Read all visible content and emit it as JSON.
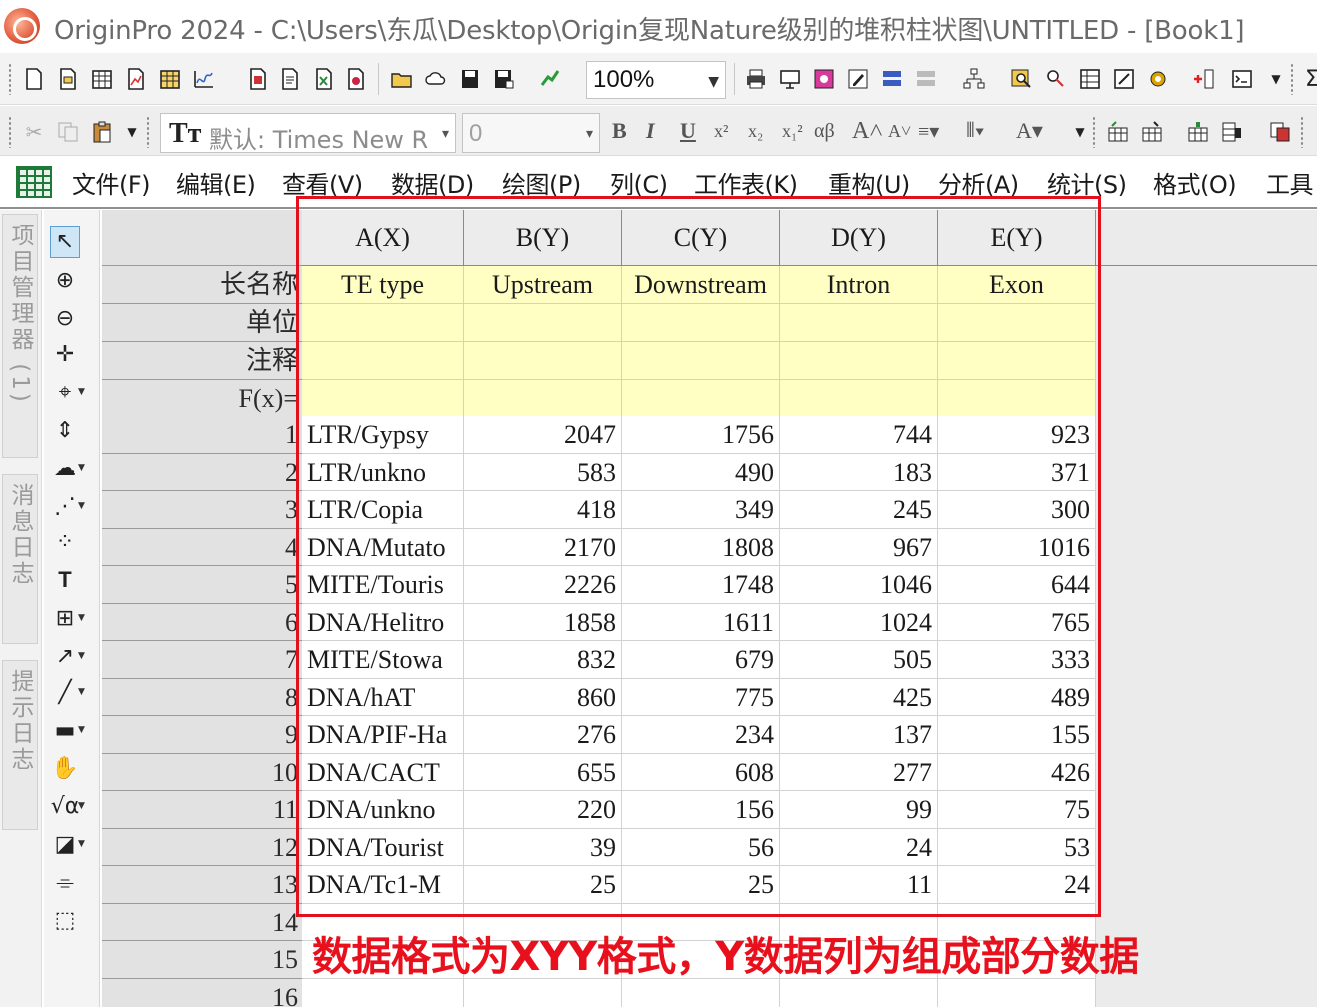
{
  "window": {
    "title": "OriginPro 2024 - C:\\Users\\东瓜\\Desktop\\Origin复现Nature级别的堆积柱状图\\UNTITLED - [Book1]"
  },
  "toolbar": {
    "zoom_value": "100%",
    "font_name": "默认: Times New R",
    "font_size": "0",
    "icons": [
      "new-project-icon",
      "open-icon",
      "new-workbook-icon",
      "new-graph-icon",
      "new-matrix-icon",
      "new-function-icon",
      "import-icon",
      "save-icon",
      "print-icon",
      "run-icon"
    ]
  },
  "menu": {
    "items": [
      "文件(F)",
      "编辑(E)",
      "查看(V)",
      "数据(D)",
      "绘图(P)",
      "列(C)",
      "工作表(K)",
      "重构(U)",
      "分析(A)",
      "统计(S)",
      "格式(O)",
      "工具"
    ]
  },
  "dock": {
    "tabs": [
      "项目管理器 (1)",
      "消息日志",
      "提示日志"
    ]
  },
  "worksheet": {
    "columns": [
      {
        "header": "A(X)",
        "long_name": "TE type"
      },
      {
        "header": "B(Y)",
        "long_name": "Upstream"
      },
      {
        "header": "C(Y)",
        "long_name": "Downstream"
      },
      {
        "header": "D(Y)",
        "long_name": "Intron"
      },
      {
        "header": "E(Y)",
        "long_name": "Exon"
      }
    ],
    "meta_labels": [
      "长名称",
      "单位",
      "注释",
      "F(x)="
    ],
    "row_numbers": [
      "1",
      "2",
      "3",
      "4",
      "5",
      "6",
      "7",
      "8",
      "9",
      "10",
      "11",
      "12",
      "13",
      "14",
      "15",
      "16"
    ],
    "rows": [
      [
        "LTR/Gypsy",
        "2047",
        "1756",
        "744",
        "923"
      ],
      [
        "LTR/unkno",
        "583",
        "490",
        "183",
        "371"
      ],
      [
        "LTR/Copia",
        "418",
        "349",
        "245",
        "300"
      ],
      [
        "DNA/Mutato",
        "2170",
        "1808",
        "967",
        "1016"
      ],
      [
        "MITE/Touris",
        "2226",
        "1748",
        "1046",
        "644"
      ],
      [
        "DNA/Helitro",
        "1858",
        "1611",
        "1024",
        "765"
      ],
      [
        "MITE/Stowa",
        "832",
        "679",
        "505",
        "333"
      ],
      [
        "DNA/hAT",
        "860",
        "775",
        "425",
        "489"
      ],
      [
        "DNA/PIF-Ha",
        "276",
        "234",
        "137",
        "155"
      ],
      [
        "DNA/CACT",
        "655",
        "608",
        "277",
        "426"
      ],
      [
        "DNA/unkno",
        "220",
        "156",
        "99",
        "75"
      ],
      [
        "DNA/Tourist",
        "39",
        "56",
        "24",
        "53"
      ],
      [
        "DNA/Tc1-M",
        "25",
        "25",
        "11",
        "24"
      ]
    ]
  },
  "annotation": {
    "caption": "数据格式为XYY格式，Y数据列为组成部分数据",
    "box_color": "#e1101c"
  }
}
